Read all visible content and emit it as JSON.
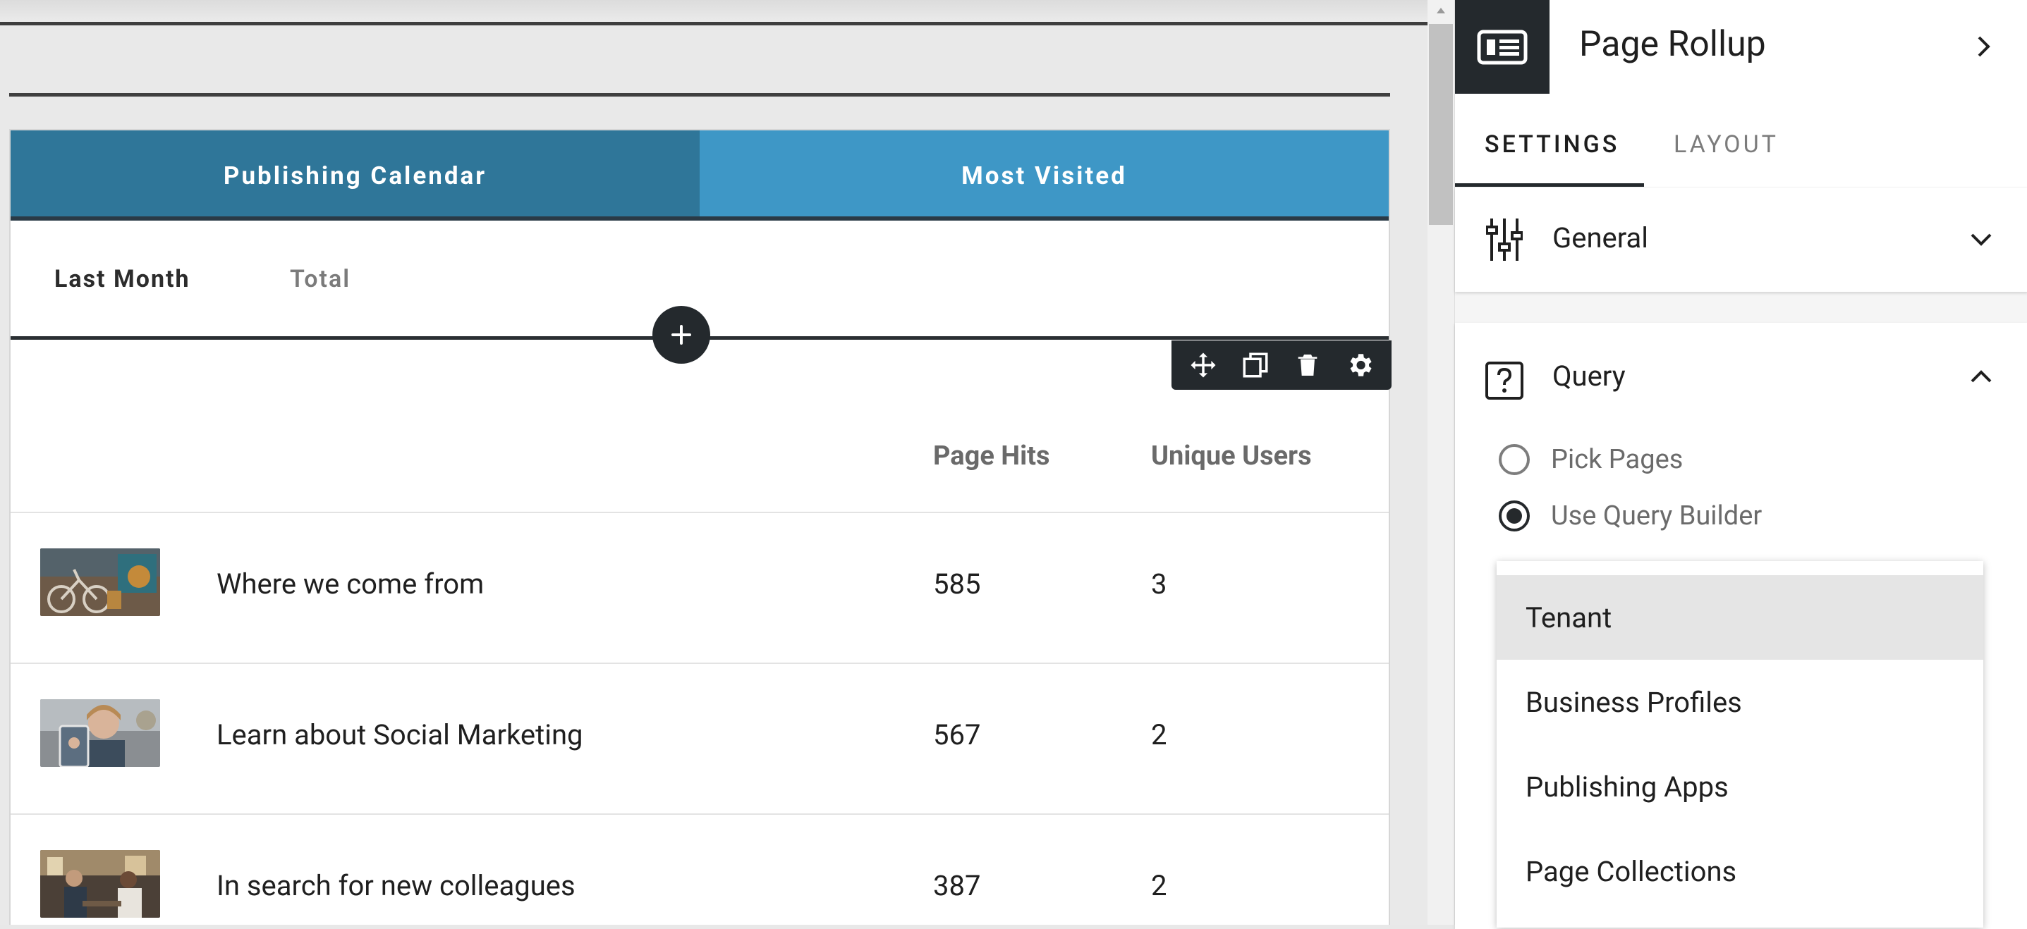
{
  "canvas": {
    "tabs": [
      {
        "label": "Publishing Calendar",
        "active": true
      },
      {
        "label": "Most Visited",
        "active": false
      }
    ],
    "subtabs": [
      {
        "label": "Last Month",
        "active": true
      },
      {
        "label": "Total",
        "active": false
      }
    ],
    "toolbar_icons": [
      "move-icon",
      "copy-icon",
      "delete-icon",
      "settings-icon"
    ],
    "table": {
      "headers": {
        "page_hits": "Page Hits",
        "unique_users": "Unique Users"
      },
      "rows": [
        {
          "title": "Where we come from",
          "page_hits": "585",
          "unique_users": "3"
        },
        {
          "title": "Learn about Social Marketing",
          "page_hits": "567",
          "unique_users": "2"
        },
        {
          "title": "In search for new colleagues",
          "page_hits": "387",
          "unique_users": "2"
        }
      ]
    }
  },
  "panel": {
    "title": "Page Rollup",
    "tabs": [
      {
        "label": "SETTINGS",
        "active": true
      },
      {
        "label": "LAYOUT",
        "active": false
      }
    ],
    "sections": {
      "general": {
        "label": "General"
      },
      "query": {
        "label": "Query"
      }
    },
    "query_options": [
      {
        "label": "Pick Pages",
        "checked": false
      },
      {
        "label": "Use Query Builder",
        "checked": true
      }
    ],
    "dropdown": {
      "items": [
        "Tenant",
        "Business Profiles",
        "Publishing Apps",
        "Page Collections"
      ],
      "highlighted": "Tenant"
    }
  },
  "colors": {
    "tab_active": "#2f7699",
    "tab_inactive": "#3e97c6",
    "dark": "#24292d"
  }
}
